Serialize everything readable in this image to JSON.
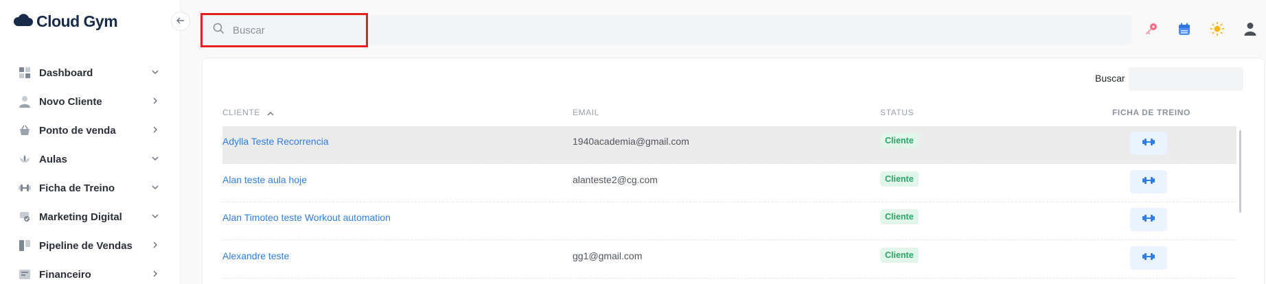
{
  "app": {
    "logo_text": "Cloud Gym"
  },
  "sidebar": {
    "items": [
      {
        "label": "Dashboard",
        "icon": "dashboard-icon",
        "caret": "down"
      },
      {
        "label": "Novo Cliente",
        "icon": "user-icon",
        "caret": "right"
      },
      {
        "label": "Ponto de venda",
        "icon": "basket-icon",
        "caret": "right"
      },
      {
        "label": "Aulas",
        "icon": "lotus-icon",
        "caret": "down"
      },
      {
        "label": "Ficha de Treino",
        "icon": "dumbbell-icon",
        "caret": "down"
      },
      {
        "label": "Marketing Digital",
        "icon": "megaphone-icon",
        "caret": "down"
      },
      {
        "label": "Pipeline de Vendas",
        "icon": "pipeline-icon",
        "caret": "right"
      },
      {
        "label": "Financeiro",
        "icon": "wallet-icon",
        "caret": "right"
      }
    ]
  },
  "topbar": {
    "search_placeholder": "Buscar",
    "icons": [
      "key-icon",
      "calendar-icon",
      "sun-icon",
      "user-icon"
    ]
  },
  "table": {
    "search_label": "Buscar",
    "headers": {
      "cliente": "CLIENTE",
      "email": "EMAIL",
      "status": "STATUS",
      "ficha": "FICHA DE TREINO"
    },
    "rows": [
      {
        "name": "Adylla Teste Recorrencia",
        "email": "1940academia@gmail.com",
        "status": "Cliente"
      },
      {
        "name": "Alan teste aula hoje",
        "email": "alanteste2@cg.com",
        "status": "Cliente"
      },
      {
        "name": "Alan Timoteo teste Workout automation",
        "email": "",
        "status": "Cliente"
      },
      {
        "name": "Alexandre teste",
        "email": "gg1@gmail.com",
        "status": "Cliente"
      }
    ]
  },
  "colors": {
    "link": "#2f7de1",
    "badge_text": "#2aa467",
    "badge_bg": "#e2f5ea",
    "highlight_border": "#e4201f",
    "logo": "#182b49"
  }
}
